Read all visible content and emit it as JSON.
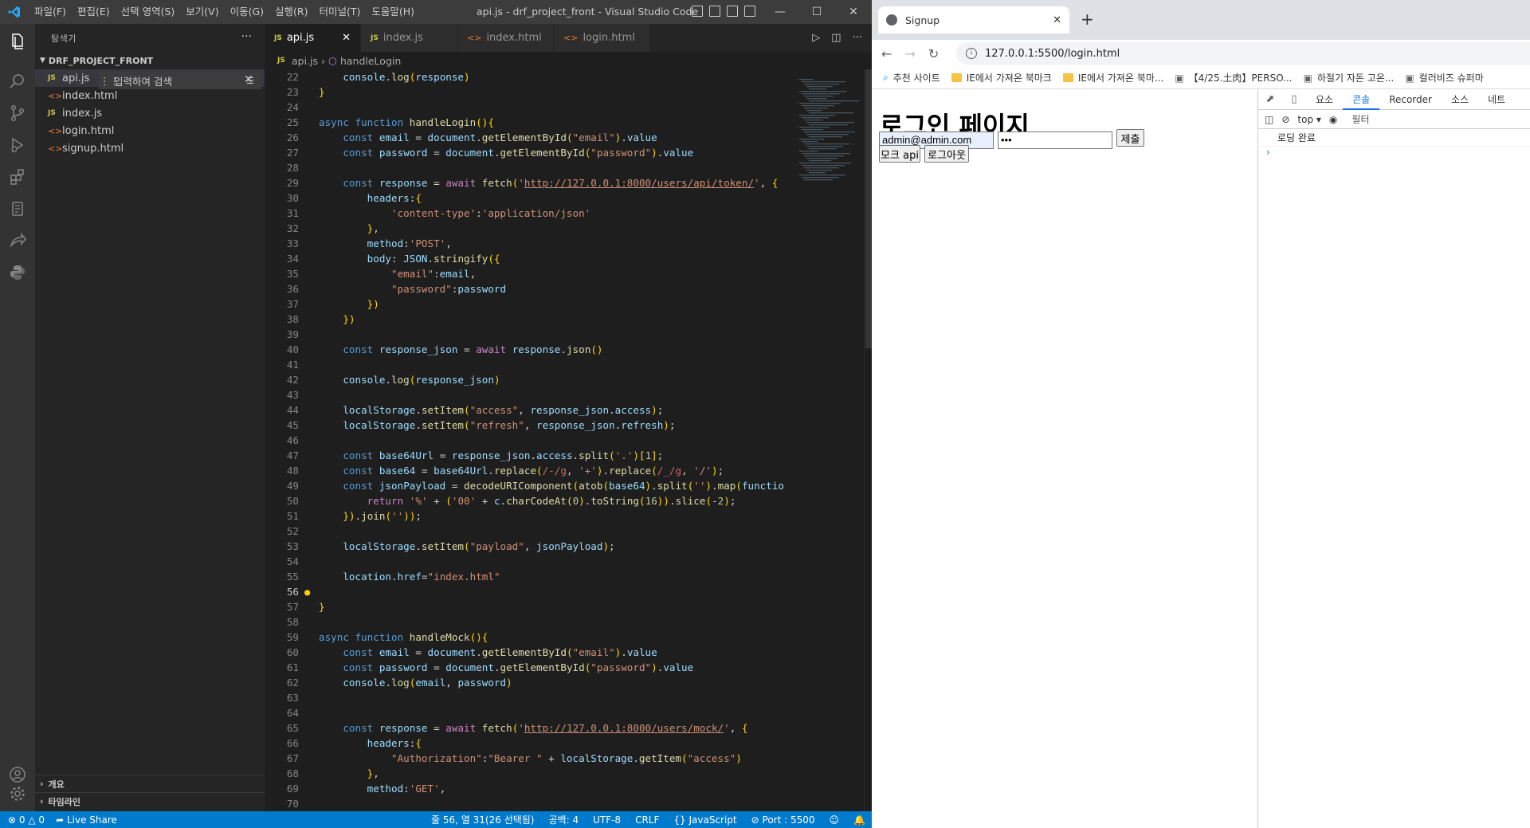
{
  "vscode": {
    "menu": [
      "파일(F)",
      "편집(E)",
      "선택 영역(S)",
      "보기(V)",
      "이동(G)",
      "실행(R)",
      "터미널(T)",
      "도움말(H)"
    ],
    "window_title": "api.js - drf_project_front - Visual Studio Code",
    "sidebar": {
      "title": "탐색기",
      "folder": "DRF_PROJECT_FRONT",
      "files": [
        {
          "name": "api.js",
          "type": "js"
        },
        {
          "name": "index.html",
          "type": "html"
        },
        {
          "name": "index.js",
          "type": "js"
        },
        {
          "name": "login.html",
          "type": "html"
        },
        {
          "name": "signup.html",
          "type": "html"
        }
      ],
      "find_placeholder": "입력하여 검색",
      "outline": "개요",
      "timeline": "타임라인"
    },
    "tabs": [
      {
        "label": "api.js",
        "type": "js",
        "active": true
      },
      {
        "label": "index.js",
        "type": "js",
        "active": false
      },
      {
        "label": "index.html",
        "type": "html",
        "active": false
      },
      {
        "label": "login.html",
        "type": "html",
        "active": false
      }
    ],
    "breadcrumb": [
      "api.js",
      "handleLogin"
    ],
    "code_lines": [
      {
        "n": 22,
        "t": "    console.log(response)"
      },
      {
        "n": 23,
        "t": "}"
      },
      {
        "n": 24,
        "t": ""
      },
      {
        "n": 25,
        "t": "async function handleLogin(){"
      },
      {
        "n": 26,
        "t": "    const email = document.getElementById(\"email\").value"
      },
      {
        "n": 27,
        "t": "    const password = document.getElementById(\"password\").value"
      },
      {
        "n": 28,
        "t": ""
      },
      {
        "n": 29,
        "t": "    const response = await fetch('http://127.0.0.1:8000/users/api/token/', {"
      },
      {
        "n": 30,
        "t": "        headers:{"
      },
      {
        "n": 31,
        "t": "            'content-type':'application/json'"
      },
      {
        "n": 32,
        "t": "        },"
      },
      {
        "n": 33,
        "t": "        method:'POST',"
      },
      {
        "n": 34,
        "t": "        body: JSON.stringify({"
      },
      {
        "n": 35,
        "t": "            \"email\":email,"
      },
      {
        "n": 36,
        "t": "            \"password\":password"
      },
      {
        "n": 37,
        "t": "        })"
      },
      {
        "n": 38,
        "t": "    })"
      },
      {
        "n": 39,
        "t": ""
      },
      {
        "n": 40,
        "t": "    const response_json = await response.json()"
      },
      {
        "n": 41,
        "t": ""
      },
      {
        "n": 42,
        "t": "    console.log(response_json)"
      },
      {
        "n": 43,
        "t": ""
      },
      {
        "n": 44,
        "t": "    localStorage.setItem(\"access\", response_json.access);"
      },
      {
        "n": 45,
        "t": "    localStorage.setItem(\"refresh\", response_json.refresh);"
      },
      {
        "n": 46,
        "t": ""
      },
      {
        "n": 47,
        "t": "    const base64Url = response_json.access.split('.')[1];"
      },
      {
        "n": 48,
        "t": "    const base64 = base64Url.replace(/-/g, '+').replace(/_/g, '/');"
      },
      {
        "n": 49,
        "t": "    const jsonPayload = decodeURIComponent(atob(base64).split('').map(functio"
      },
      {
        "n": 50,
        "t": "        return '%' + ('00' + c.charCodeAt(0).toString(16)).slice(-2);"
      },
      {
        "n": 51,
        "t": "    }).join(''));"
      },
      {
        "n": 52,
        "t": ""
      },
      {
        "n": 53,
        "t": "    localStorage.setItem(\"payload\", jsonPayload);"
      },
      {
        "n": 54,
        "t": ""
      },
      {
        "n": 55,
        "t": "    location.href=\"index.html\""
      },
      {
        "n": 56,
        "t": ""
      },
      {
        "n": 57,
        "t": "}"
      },
      {
        "n": 58,
        "t": ""
      },
      {
        "n": 59,
        "t": "async function handleMock(){"
      },
      {
        "n": 60,
        "t": "    const email = document.getElementById(\"email\").value"
      },
      {
        "n": 61,
        "t": "    const password = document.getElementById(\"password\").value"
      },
      {
        "n": 62,
        "t": "    console.log(email, password)"
      },
      {
        "n": 63,
        "t": ""
      },
      {
        "n": 64,
        "t": ""
      },
      {
        "n": 65,
        "t": "    const response = await fetch('http://127.0.0.1:8000/users/mock/', {"
      },
      {
        "n": 66,
        "t": "        headers:{"
      },
      {
        "n": 67,
        "t": "            \"Authorization\":\"Bearer \" + localStorage.getItem(\"access\")"
      },
      {
        "n": 68,
        "t": "        },"
      },
      {
        "n": 69,
        "t": "        method:'GET',"
      },
      {
        "n": 70,
        "t": ""
      }
    ],
    "display_line_numbers": [
      22,
      23,
      24,
      25,
      26,
      27,
      28,
      29,
      30,
      31,
      32,
      33,
      34,
      35,
      36,
      37,
      38,
      39,
      40,
      41,
      42,
      43,
      44,
      45,
      46,
      47,
      48,
      49,
      50,
      51,
      52,
      53,
      54,
      55,
      56,
      57,
      58,
      59,
      60,
      61,
      62,
      63,
      64,
      65,
      66,
      67,
      68,
      69,
      70
    ],
    "status": {
      "errors": "0",
      "warnings": "0",
      "live_share": "Live Share",
      "position": "줄 56, 열 31(26 선택됨)",
      "spaces": "공백: 4",
      "encoding": "UTF-8",
      "eol": "CRLF",
      "language": "JavaScript",
      "port": "Port : 5500"
    }
  },
  "browser": {
    "tab_title": "Signup",
    "url": "127.0.0.1:5500/login.html",
    "bookmarks": [
      "추천 사이트",
      "IE에서 가져온 북마크",
      "IE에서 가져온 북마...",
      "【4/25.土肉】PERSO...",
      "하절기 자돈 고온...",
      "컬러비즈 슈퍼마"
    ],
    "page": {
      "heading": "로그인 페이지",
      "email_value": "admin@admin.com",
      "password_value": "•••",
      "submit_label": "제출",
      "mock_label": "모크 api",
      "logout_label": "로그아웃"
    },
    "devtools": {
      "tabs": [
        "요소",
        "콘솔",
        "Recorder",
        "소스",
        "네트"
      ],
      "context": "top",
      "filter_placeholder": "필터",
      "log_message": "로딩 완료"
    }
  },
  "colors": {
    "statusbar": "#007acc",
    "activitybar": "#333333",
    "sidebar": "#252526",
    "editor": "#1e1e1e"
  }
}
